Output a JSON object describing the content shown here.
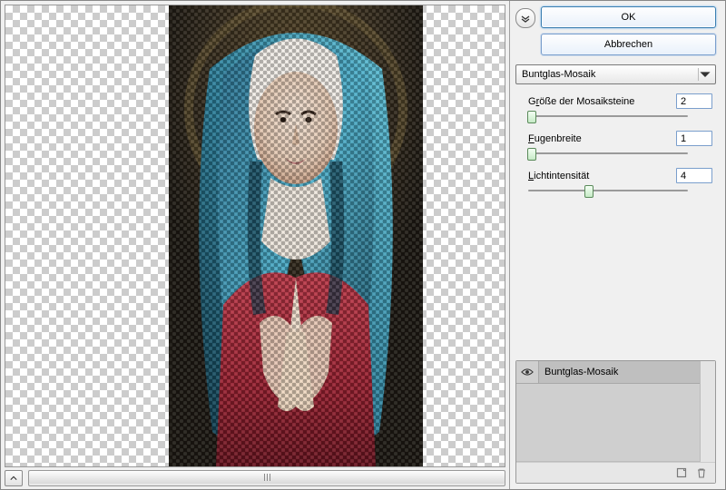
{
  "buttons": {
    "ok": "OK",
    "cancel": "Abbrechen"
  },
  "filter_dropdown": {
    "selected": "Buntglas-Mosaik"
  },
  "params": {
    "cell_size": {
      "label_pre": "G",
      "label_u": "r",
      "label_post": "öße der Mosaiksteine",
      "value": "2",
      "pct": 2
    },
    "border": {
      "label_pre": "",
      "label_u": "F",
      "label_post": "ugenbreite",
      "value": "1",
      "pct": 2
    },
    "light": {
      "label_pre": "",
      "label_u": "L",
      "label_post": "ichtintensität",
      "value": "4",
      "pct": 38
    }
  },
  "layers": {
    "row1": "Buntglas-Mosaik"
  }
}
